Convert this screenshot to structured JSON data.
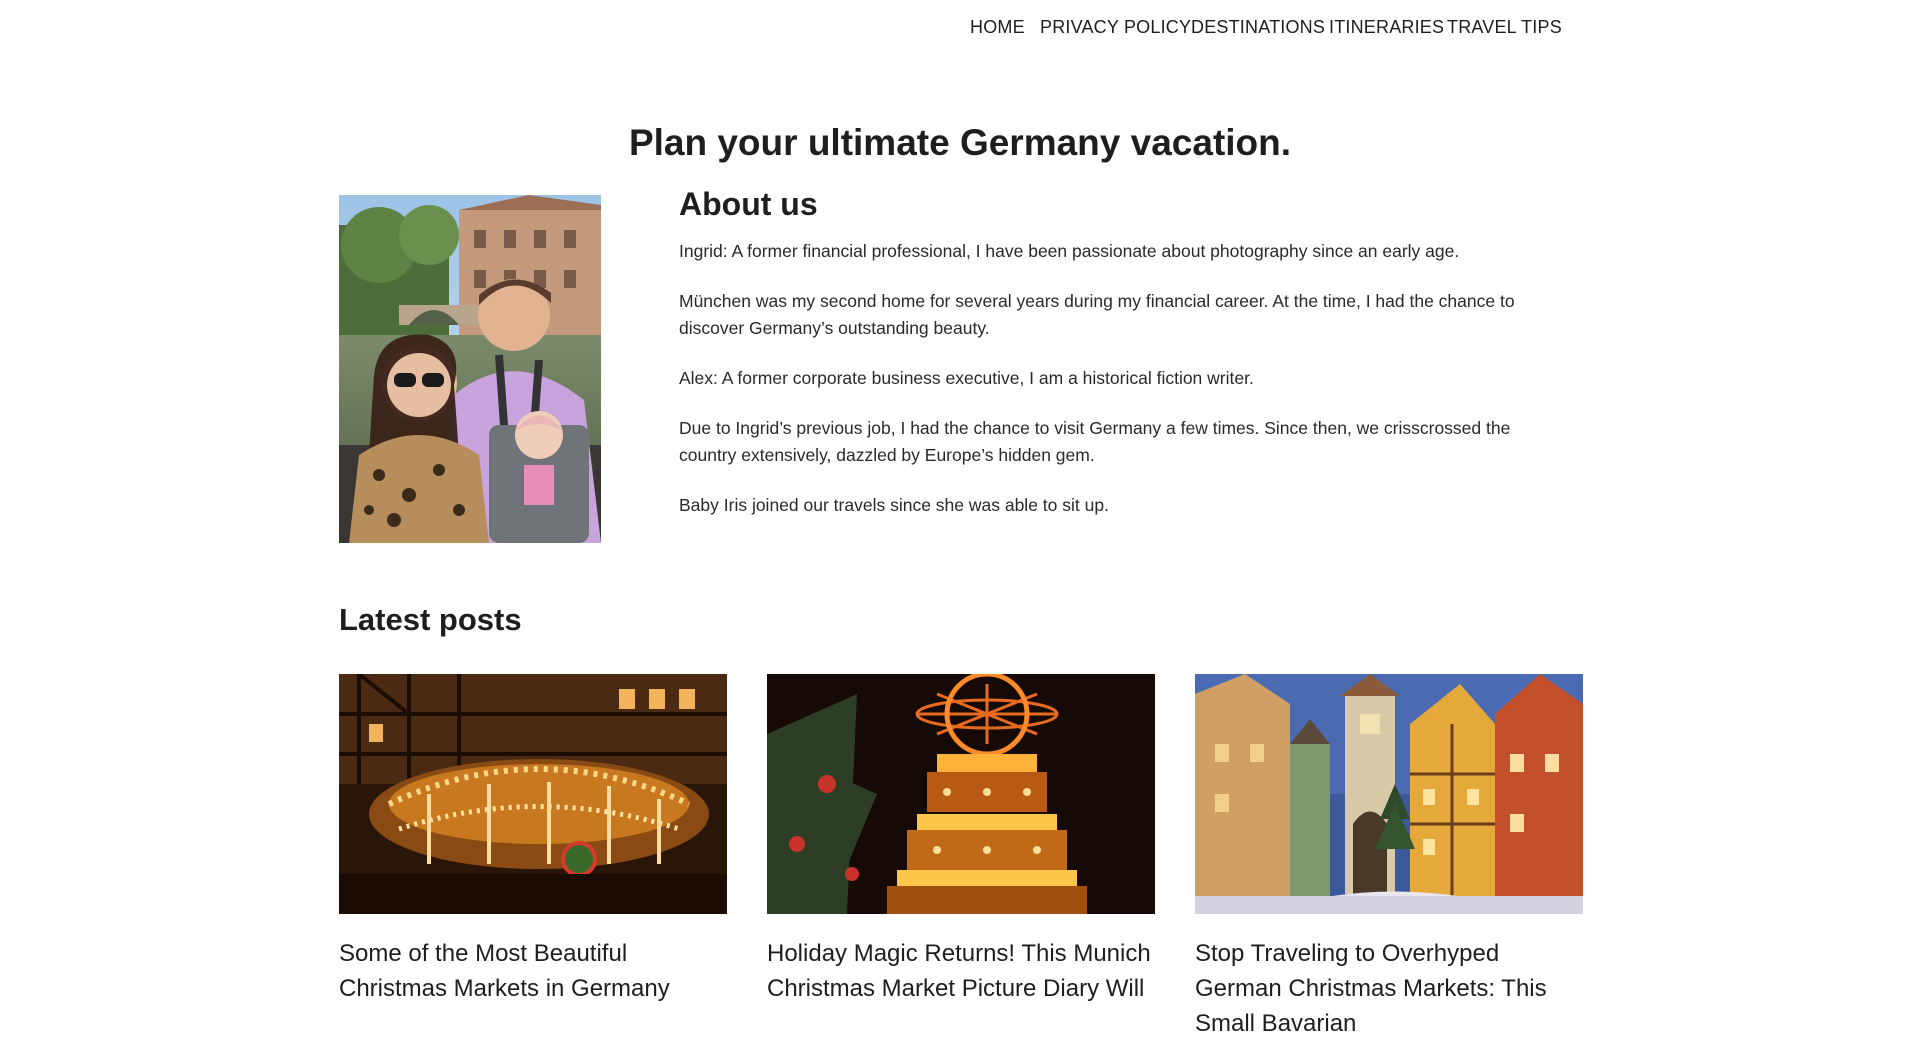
{
  "nav": {
    "items": [
      {
        "label": "HOME"
      },
      {
        "label": "PRIVACY POLICY"
      },
      {
        "label": "DESTINATIONS"
      },
      {
        "label": "ITINERARIES"
      },
      {
        "label": "TRAVEL TIPS"
      }
    ]
  },
  "hero": {
    "title": "Plan your ultimate Germany vacation."
  },
  "about": {
    "heading": "About us",
    "paragraphs": [
      "Ingrid: A former financial professional, I have been passionate about photography since an early age.",
      "München was my second home for several years during my financial career. At the time, I had the chance to discover Germany’s outstanding beauty.",
      "Alex: A former corporate business executive, I am a historical fiction writer.",
      "Due to Ingrid’s previous job, I had the chance to visit Germany a few times. Since then, we crisscrossed the country extensively, dazzled by Europe’s hidden gem.",
      "Baby Iris joined our travels since she was able to sit up."
    ]
  },
  "latest": {
    "heading": "Latest posts",
    "posts": [
      {
        "title": "Some of the Most Beautiful Christmas Markets in Germany"
      },
      {
        "title": "Holiday Magic Returns! This Munich Christmas Market Picture Diary Will"
      },
      {
        "title": "Stop Traveling to Overhyped German Christmas Markets: This Small Bavarian"
      }
    ]
  }
}
